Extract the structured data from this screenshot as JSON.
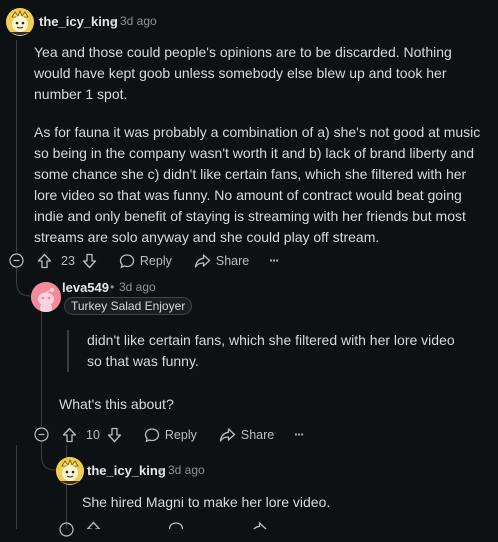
{
  "comments": [
    {
      "username": "the_icy_king",
      "separator": "•",
      "time": "3d ago",
      "paragraphs": [
        "Yea and those could people's opinions are to be discarded. Nothing would have kept goob unless somebody else blew up and took her number 1 spot.",
        "As for fauna it was probably a combination of a) she's not good at music so being in the company wasn't worth it and b) lack of brand liberty and some chance she c) didn't like certain fans, which she filtered with her lore video so that was funny. No amount of contract would beat going indie and only benefit of staying is streaming with her friends but most streams are solo anyway and she could play off stream."
      ],
      "votes": "23",
      "reply_label": "Reply",
      "share_label": "Share",
      "more_label": "···"
    },
    {
      "username": "leva549",
      "separator": "•",
      "time": "3d ago",
      "flair": "Turkey Salad Enjoyer",
      "quote": "didn't like certain fans, which she filtered with her lore video so that was funny.",
      "text": "What's this about?",
      "votes": "10",
      "reply_label": "Reply",
      "share_label": "Share",
      "more_label": "···"
    },
    {
      "username": "the_icy_king",
      "separator": "•",
      "time": "3d ago",
      "text": "She hired Magni to make her lore video."
    }
  ],
  "colors": {
    "background": "#0e1113",
    "thread_line": "#3a3d40",
    "muted_text": "#8b9296",
    "leva_avatar": "#f28b9a"
  },
  "icons": [
    "collapse-icon",
    "upvote-icon",
    "downvote-icon",
    "reply-icon",
    "share-icon",
    "more-icon"
  ]
}
